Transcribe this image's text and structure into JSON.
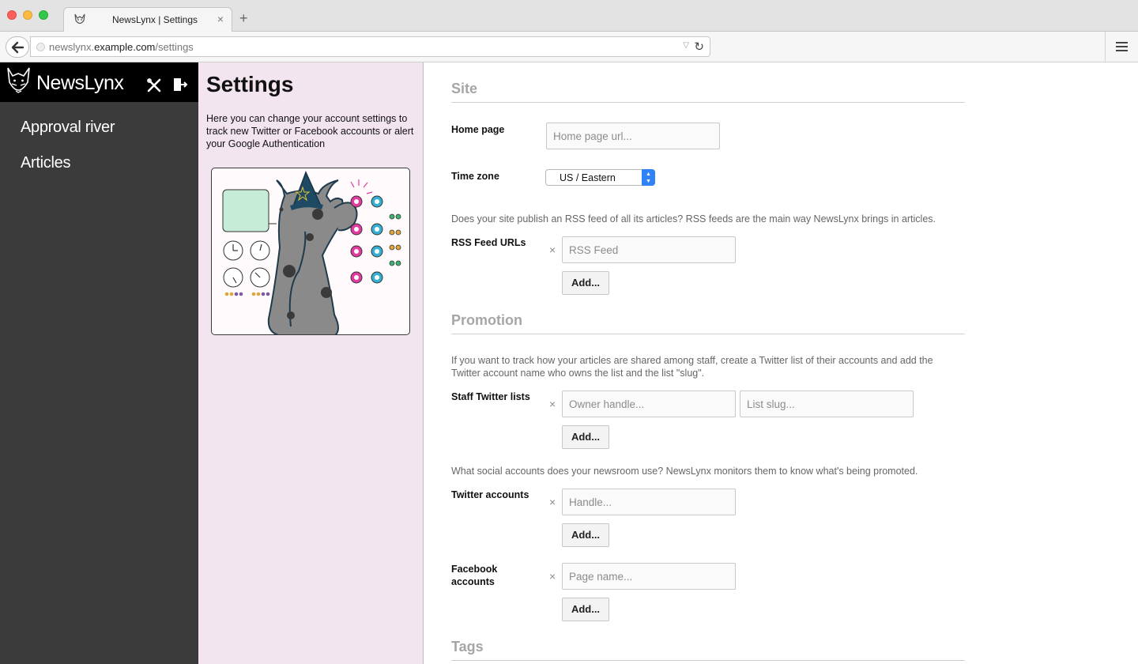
{
  "browser": {
    "tab_title": "NewsLynx | Settings",
    "url_plain": "newslynx.",
    "url_host": "example.com",
    "url_path": "/settings",
    "new_tab_symbol": "+",
    "tab_close_symbol": "×"
  },
  "sidebar": {
    "brand": "NewsLynx",
    "nav": [
      {
        "label": "Approval river"
      },
      {
        "label": "Articles"
      }
    ],
    "icons": [
      "tools-icon",
      "logout-icon"
    ]
  },
  "info": {
    "title": "Settings",
    "description": "Here you can change your account settings to track new Twitter or Facebook accounts or alert your Google Authentication"
  },
  "site": {
    "title": "Site",
    "home_page_label": "Home page",
    "home_page_placeholder": "Home page url...",
    "time_zone_label": "Time zone",
    "time_zone_value": "US / Eastern",
    "rss_hint": "Does your site publish an RSS feed of all its articles? RSS feeds are the main way NewsLynx brings in articles.",
    "rss_label": "RSS Feed URLs",
    "rss_placeholder": "RSS Feed",
    "add_label": "Add..."
  },
  "promotion": {
    "title": "Promotion",
    "staff_hint": "If you want to track how your articles are shared among staff, create a Twitter list of their accounts and add the Twitter account name who owns the list and the list \"slug\".",
    "staff_label": "Staff Twitter lists",
    "owner_placeholder": "Owner handle...",
    "slug_placeholder": "List slug...",
    "social_hint": "What social accounts does your newsroom use? NewsLynx monitors them to know what's being promoted.",
    "twitter_label": "Twitter accounts",
    "twitter_placeholder": "Handle...",
    "facebook_label": "Facebook accounts",
    "facebook_placeholder": "Page name...",
    "add_label": "Add...",
    "remove_symbol": "×"
  },
  "tags": {
    "title": "Tags"
  }
}
